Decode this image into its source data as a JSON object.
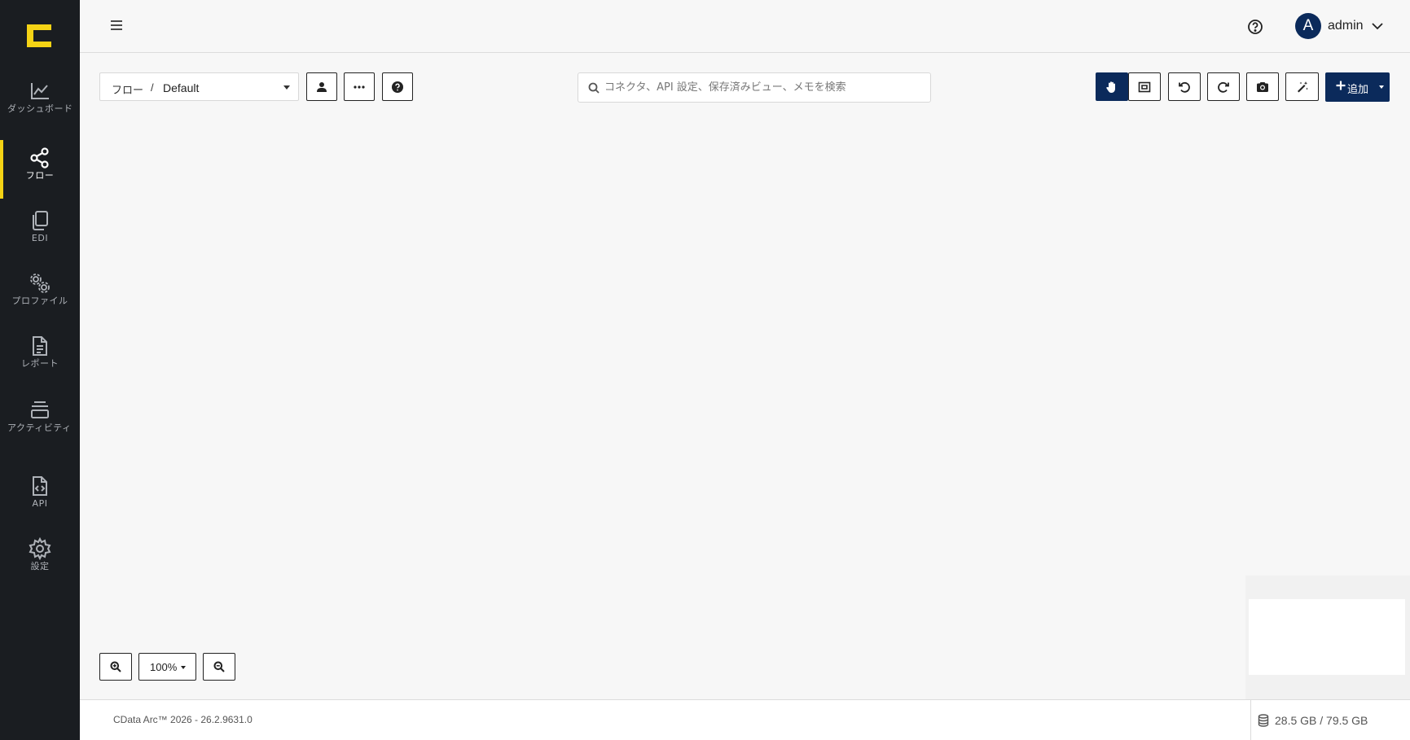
{
  "sidebar": {
    "items": [
      {
        "label": "ダッシュボード",
        "icon": "chart-line-icon"
      },
      {
        "label": "フロー",
        "icon": "share-nodes-icon",
        "active": true
      },
      {
        "label": "EDI",
        "icon": "copy-icon"
      },
      {
        "label": "プロファイル",
        "icon": "gears-icon"
      },
      {
        "label": "レポート",
        "icon": "file-lines-icon"
      },
      {
        "label": "アクティビティ",
        "icon": "layers-icon"
      },
      {
        "label": "API",
        "icon": "file-code-icon"
      },
      {
        "label": "設定",
        "icon": "gear-icon"
      }
    ]
  },
  "header": {
    "user_initial": "A",
    "user_name": "admin"
  },
  "toolbar": {
    "breadcrumb": "フロー",
    "breadcrumb_sep": "/",
    "flow_name": "Default",
    "search_placeholder": "コネクタ、API 設定、保存済みビュー、メモを検索",
    "add_label": "追加"
  },
  "zoom": {
    "level": "100%"
  },
  "footer": {
    "version": "CData Arc™ 2026 - 26.2.9631.0",
    "disk_usage": "28.5 GB / 79.5 GB"
  },
  "colors": {
    "sidebar_bg": "#1a1d21",
    "accent_yellow": "#f5d315",
    "primary_navy": "#0b2a5b"
  }
}
